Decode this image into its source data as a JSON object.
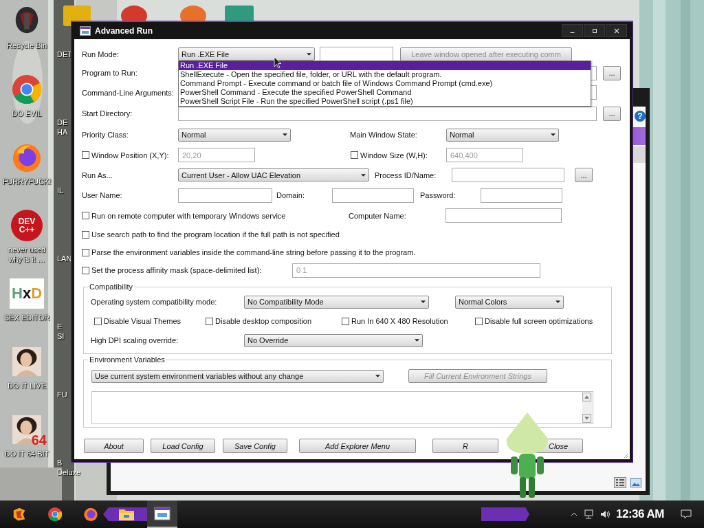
{
  "desktop": {
    "icons": [
      {
        "kind": "bin",
        "label": "Recycle Bin"
      },
      {
        "kind": "chrome",
        "label": "DO EVIL"
      },
      {
        "kind": "firefox",
        "label": "FURRYFUCK!"
      },
      {
        "kind": "dev",
        "label": "never used why is it …",
        "badge": [
          "DEV",
          "C++"
        ]
      },
      {
        "kind": "hxd",
        "label": "SEX EDITOR",
        "badge": [
          "H",
          "x",
          "D"
        ]
      },
      {
        "kind": "portrait",
        "label": "DO IT LIVE"
      },
      {
        "kind": "portrait",
        "label": "DO IT 64 BIT",
        "badge": [
          "64"
        ]
      }
    ],
    "column_2": [
      {
        "lines": [
          "DET"
        ]
      },
      {
        "lines": [
          "DE",
          "HA"
        ]
      },
      {
        "lines": [
          "IL"
        ]
      },
      {
        "lines": [
          "LAN"
        ]
      },
      {
        "lines": [
          "E",
          "SI"
        ]
      },
      {
        "lines": [
          "FU"
        ]
      },
      {
        "lines": [
          "B",
          "Deluxe"
        ]
      }
    ]
  },
  "back_window": {
    "help_button": "?"
  },
  "window": {
    "title": "Advanced Run"
  },
  "run_mode": {
    "label": "Run Mode:",
    "value": "Run .EXE File"
  },
  "leave_open_button": {
    "label": "Leave window opened after executing comm",
    "disabled": true
  },
  "run_mode_list": [
    {
      "label": "Run .EXE File",
      "selected": true
    },
    {
      "label": "ShellExecute - Open the specified file, folder, or URL with the default program.",
      "selected": false
    },
    {
      "label": "Command Prompt - Execute command or batch file of Windows Command Prompt (cmd.exe)",
      "selected": false
    },
    {
      "label": "PowerShell Command - Execute the specified PowerShell Command",
      "selected": false
    },
    {
      "label": "PowerShell Script File - Run the specified PowerShell script (.ps1 file)",
      "selected": false
    }
  ],
  "program": {
    "label": "Program to Run:",
    "browse": "..."
  },
  "arguments": {
    "label": "Command-Line Arguments:"
  },
  "start_directory": {
    "label": "Start Directory:",
    "browse": "..."
  },
  "priority_class": {
    "label": "Priority Class:",
    "value": "Normal"
  },
  "main_window_state": {
    "label": "Main Window State:",
    "value": "Normal"
  },
  "window_position": {
    "label": "Window Position (X,Y):",
    "checked": false,
    "value": "20,20",
    "disabled": true
  },
  "window_size": {
    "label": "Window Size (W,H):",
    "checked": false,
    "value": "640,400",
    "disabled": true
  },
  "run_as": {
    "label": "Run As...",
    "value": "Current User - Allow UAC Elevation"
  },
  "process": {
    "label": "Process ID/Name:",
    "browse": "..."
  },
  "user_name": {
    "label": "User Name:"
  },
  "domain": {
    "label": "Domain:"
  },
  "password": {
    "label": "Password:"
  },
  "remote": {
    "label": "Run on remote computer with temporary Windows service",
    "checked": false
  },
  "computer_name": {
    "label": "Computer Name:"
  },
  "search_path": {
    "label": "Use search path to find the program location if the full path is not specified",
    "checked": false
  },
  "parse_env": {
    "label": "Parse the environment variables inside the command-line string before passing it to the program.",
    "checked": false
  },
  "affinity": {
    "label": "Set the process affinity mask (space-delimited list):",
    "checked": false,
    "value": "0 1",
    "disabled": true
  },
  "compatibility": {
    "title": "Compatibility",
    "mode_label": "Operating system compatibility mode:",
    "mode": "No Compatibility Mode",
    "colors": "Normal Colors",
    "checkboxes": [
      {
        "label": "Disable Visual Themes",
        "checked": false
      },
      {
        "label": "Disable desktop composition",
        "checked": false
      },
      {
        "label": "Run In 640 X 480 Resolution",
        "checked": false
      },
      {
        "label": "Disable full screen optimizations",
        "checked": false
      }
    ],
    "dpi_label": "High DPI scaling override:",
    "dpi": "No Override"
  },
  "environment": {
    "title": "Environment Variables",
    "mode": "Use current system environment variables without any change",
    "fill_button": {
      "label": "Fill Current Environment Strings",
      "disabled": true
    }
  },
  "buttons": [
    "About",
    "Load Config",
    "Save Config",
    "Add Explorer Menu",
    "R",
    "Close"
  ],
  "taskbar": {
    "apps": [
      {
        "kind": "start",
        "selected": false
      },
      {
        "kind": "chrome",
        "selected": false
      },
      {
        "kind": "firefox",
        "selected": false
      },
      {
        "kind": "folder",
        "selected": false
      },
      {
        "kind": "app",
        "selected": true
      }
    ],
    "clock": "12:36 AM"
  }
}
